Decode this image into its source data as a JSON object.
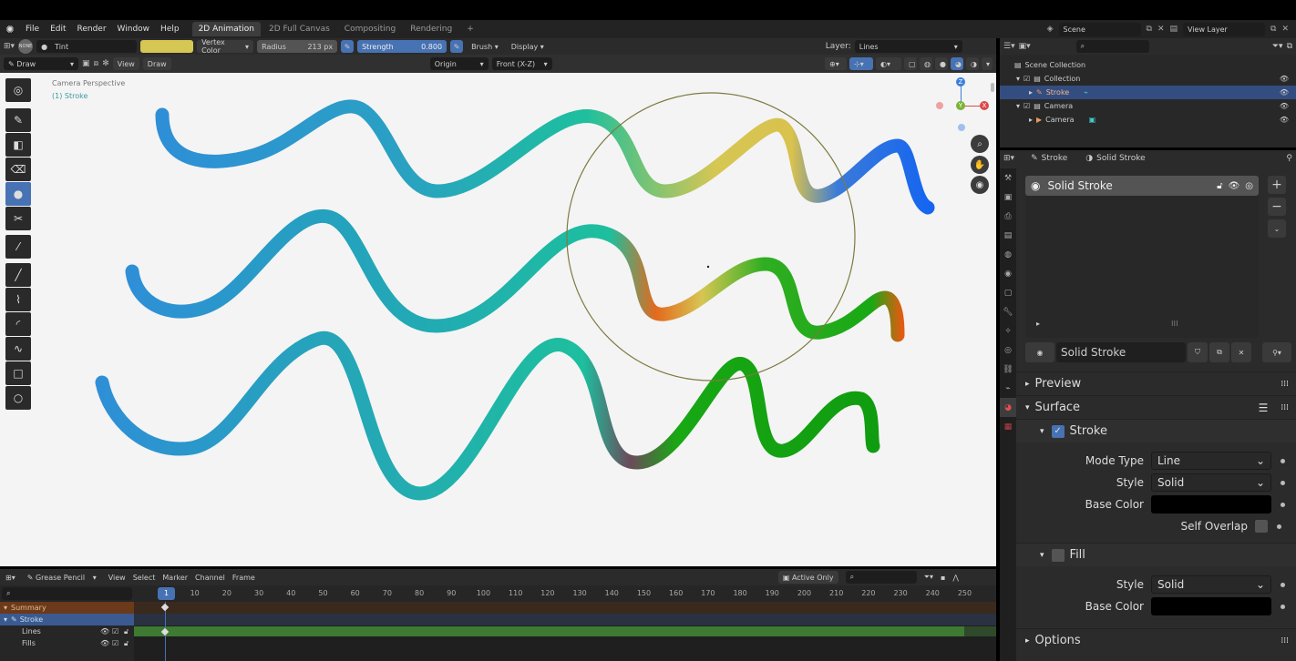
{
  "menubar": {
    "items": [
      "File",
      "Edit",
      "Render",
      "Window",
      "Help"
    ]
  },
  "workspaces": [
    "2D Animation",
    "2D Full Canvas",
    "Compositing",
    "Rendering",
    "+"
  ],
  "scene": {
    "label": "Scene",
    "view_layer": "View Layer"
  },
  "toolheader": {
    "mode_icon": "NONE",
    "brush_name": "Tint",
    "tint_color": "#d6c653",
    "color_mode": "Vertex Color",
    "radius_label": "Radius",
    "radius_value": "213 px",
    "strength_label": "Strength",
    "strength_value": "0.800",
    "brush_menu": "Brush",
    "display_menu": "Display",
    "layer_label": "Layer:",
    "layer_value": "Lines"
  },
  "viewheader": {
    "mode": "Draw",
    "view": "View",
    "draw": "Draw",
    "pivot": "Origin",
    "orientation": "Front (X-Z)"
  },
  "viewport": {
    "camera_text": "Camera Perspective",
    "object_text": "(1) Stroke",
    "gizmo": {
      "z": "Z",
      "y": "Y",
      "x": "X"
    }
  },
  "outliner": {
    "rows": [
      {
        "label": "Scene Collection",
        "indent": 0
      },
      {
        "label": "Collection",
        "indent": 1
      },
      {
        "label": "Stroke",
        "indent": 2
      },
      {
        "label": "Camera",
        "indent": 1
      },
      {
        "label": "Camera",
        "indent": 2
      }
    ]
  },
  "properties": {
    "breadcrumb_object": "Stroke",
    "breadcrumb_material": "Solid Stroke",
    "slot_name": "Solid Stroke",
    "material_name": "Solid Stroke",
    "preview": "Preview",
    "surface": "Surface",
    "stroke": "Stroke",
    "stroke_checked": true,
    "mode_type_label": "Mode Type",
    "mode_type_value": "Line",
    "style_label": "Style",
    "style_value": "Solid",
    "base_color_label": "Base Color",
    "base_color": "#000000",
    "self_overlap_label": "Self Overlap",
    "fill": "Fill",
    "fill_style_label": "Style",
    "fill_style_value": "Solid",
    "fill_base_color_label": "Base Color",
    "fill_base_color": "#000000",
    "options": "Options"
  },
  "timeline": {
    "editor": "Grease Pencil",
    "menus": [
      "View",
      "Select",
      "Marker",
      "Channel",
      "Frame"
    ],
    "active_only": "Active Only",
    "current_frame": "1",
    "ticks": [
      "10",
      "20",
      "30",
      "40",
      "50",
      "60",
      "70",
      "80",
      "90",
      "100",
      "110",
      "120",
      "130",
      "140",
      "150",
      "160",
      "170",
      "180",
      "190",
      "200",
      "210",
      "220",
      "230",
      "240",
      "250"
    ],
    "channels": [
      {
        "label": "Summary",
        "type": "summary"
      },
      {
        "label": "Stroke",
        "type": "object"
      },
      {
        "label": "Lines",
        "type": "layer"
      },
      {
        "label": "Fills",
        "type": "layer"
      }
    ]
  },
  "colors": {
    "accent": "#4772b3",
    "stroke_blue": "#2e8fd6",
    "stroke_teal": "#1dbf9e",
    "stroke_green": "#19a814",
    "stroke_yellow": "#d6c653"
  }
}
